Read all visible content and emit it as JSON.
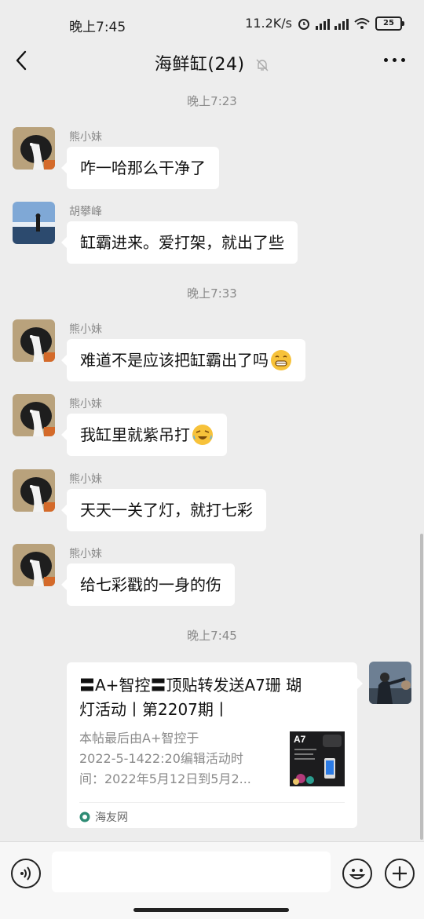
{
  "status": {
    "time": "晚上7:45",
    "speed": "11.2K/s",
    "battery": "25"
  },
  "nav": {
    "title": "海鲜缸(24)"
  },
  "time_separators": [
    "晚上7:23",
    "晚上7:33",
    "晚上7:45"
  ],
  "messages": [
    {
      "sender": "熊小妹",
      "text": "咋一哈那么干净了"
    },
    {
      "sender": "胡攀峰",
      "text": "缸霸进来。爱打架，就出了些"
    },
    {
      "sender": "熊小妹",
      "text": "难道不是应该把缸霸出了吗"
    },
    {
      "sender": "熊小妹",
      "text": "我缸里就紫吊打"
    },
    {
      "sender": "熊小妹",
      "text": "天天一关了灯，就打七彩"
    },
    {
      "sender": "熊小妹",
      "text": "给七彩戳的一身的伤"
    }
  ],
  "link_card": {
    "title_line1": "〓A+智控〓顶贴转发送A7珊 瑚",
    "title_line2": "灯活动丨第2207期丨",
    "body_line1": "本帖最后由A+智控于",
    "body_line2": "2022-5-1422:20编辑活动时",
    "body_line3": "间：2022年5月12日到5月2...",
    "thumb_label": "A7",
    "source": "海友网"
  },
  "colors": {
    "background": "#ededed",
    "bubble": "#ffffff",
    "meta_text": "#8a8a8a"
  }
}
